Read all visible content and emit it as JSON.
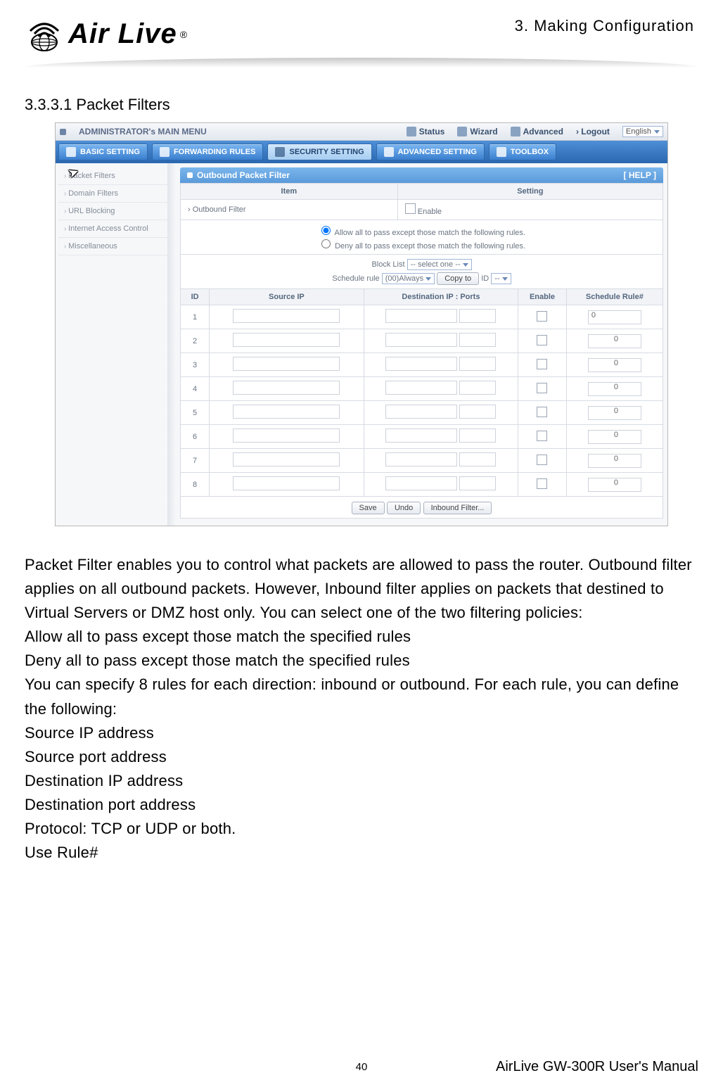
{
  "chapter": "3. Making Configuration",
  "logo": {
    "brand": "Air Live",
    "reg": "®"
  },
  "section_heading": "3.3.3.1 Packet Filters",
  "screenshot": {
    "topbar": {
      "menu_title": "ADMINISTRATOR's MAIN MENU",
      "status": "Status",
      "wizard": "Wizard",
      "advanced": "Advanced",
      "logout": "› Logout",
      "lang": "English"
    },
    "tabs": {
      "basic": "BASIC SETTING",
      "forwarding": "FORWARDING RULES",
      "security": "SECURITY SETTING",
      "advanced": "ADVANCED SETTING",
      "toolbox": "TOOLBOX"
    },
    "sidebar": [
      "Packet Filters",
      "Domain Filters",
      "URL Blocking",
      "Internet Access Control",
      "Miscellaneous"
    ],
    "panel": {
      "title": "Outbound Packet Filter",
      "help": "[ HELP ]",
      "headers": {
        "item": "Item",
        "setting": "Setting"
      },
      "row_outbound": "› Outbound Filter",
      "enable": "Enable",
      "radio_allow": "Allow all to pass except those match the following rules.",
      "radio_deny": "Deny all to pass except those match the following rules.",
      "block_list_lbl": "Block List",
      "block_list_val": "-- select one --",
      "sched_rule_lbl": "Schedule rule",
      "sched_rule_val": "(00)Always",
      "copy_to": "Copy to",
      "id_lbl": "ID",
      "tbl_headers": {
        "id": "ID",
        "src": "Source IP",
        "dst": "Destination IP : Ports",
        "en": "Enable",
        "sr": "Schedule Rule#"
      },
      "rule_default": "0",
      "buttons": {
        "save": "Save",
        "undo": "Undo",
        "inbound": "Inbound Filter..."
      }
    }
  },
  "body_text": [
    "Packet Filter enables you to control what packets are allowed to pass the router. Outbound filter applies on all outbound packets. However, Inbound filter applies on packets that destined to Virtual Servers or DMZ host only. You can select one of the two filtering policies:",
    "Allow all to pass except those match the specified rules",
    "Deny all to pass except those match the specified rules",
    "You can specify 8 rules for each direction: inbound or outbound. For each rule, you can define the following:",
    "Source IP address",
    "Source port address",
    "Destination IP address",
    "Destination port address",
    "Protocol: TCP or UDP or both.",
    "Use Rule#"
  ],
  "footer": {
    "page": "40",
    "manual": "AirLive GW-300R User's Manual"
  }
}
